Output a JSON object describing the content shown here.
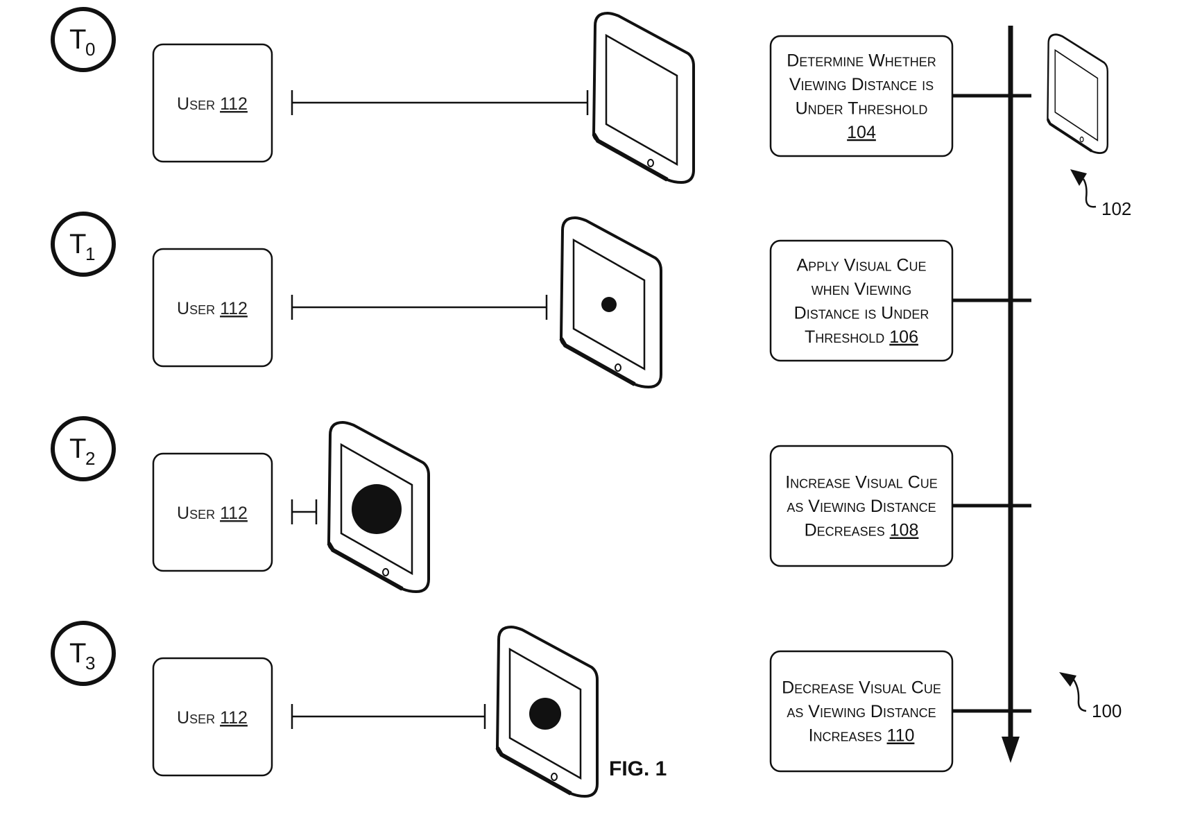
{
  "figure": {
    "caption": "FIG. 1",
    "system_ref": "100",
    "device_ref": "102"
  },
  "time_steps": [
    {
      "label": "T",
      "subscript": "0",
      "user_label": "User",
      "user_ref": "112",
      "visual_cue": "none"
    },
    {
      "label": "T",
      "subscript": "1",
      "user_label": "User",
      "user_ref": "112",
      "visual_cue": "small"
    },
    {
      "label": "T",
      "subscript": "2",
      "user_label": "User",
      "user_ref": "112",
      "visual_cue": "large"
    },
    {
      "label": "T",
      "subscript": "3",
      "user_label": "User",
      "user_ref": "112",
      "visual_cue": "medium"
    }
  ],
  "process_steps": [
    {
      "lines": [
        "Determine Whether",
        "Viewing Distance is",
        "Under Threshold"
      ],
      "ref": "104"
    },
    {
      "lines": [
        "Apply Visual Cue",
        "when Viewing",
        "Distance is Under",
        "Threshold"
      ],
      "ref": "106"
    },
    {
      "lines": [
        "Increase Visual Cue",
        "as Viewing Distance",
        "Decreases"
      ],
      "ref": "108"
    },
    {
      "lines": [
        "Decrease Visual Cue",
        "as Viewing Distance",
        "Increases"
      ],
      "ref": "110"
    }
  ],
  "colors": {
    "ink": "#111111",
    "background": "#ffffff"
  }
}
